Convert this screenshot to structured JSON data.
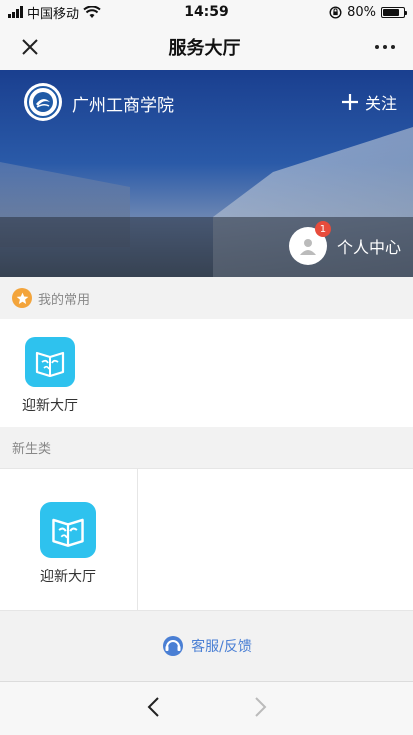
{
  "status_bar": {
    "carrier": "中国移动",
    "time": "14:59",
    "battery_percent": "80%",
    "battery_level": 0.8
  },
  "nav": {
    "title": "服务大厅"
  },
  "banner": {
    "school_name": "广州工商学院",
    "follow_label": "关注",
    "personal_center_label": "个人中心",
    "notification_count": "1"
  },
  "favorites": {
    "header": "我的常用",
    "apps": [
      {
        "label": "迎新大厅",
        "icon": "book-icon"
      }
    ]
  },
  "freshman": {
    "header": "新生类",
    "apps": [
      {
        "label": "迎新大厅",
        "icon": "book-icon"
      }
    ]
  },
  "footer": {
    "feedback_label": "客服/反馈"
  },
  "colors": {
    "accent": "#2ec2ee",
    "link": "#4a7fd4",
    "star": "#f3a43b",
    "badge": "#e74c3c"
  }
}
